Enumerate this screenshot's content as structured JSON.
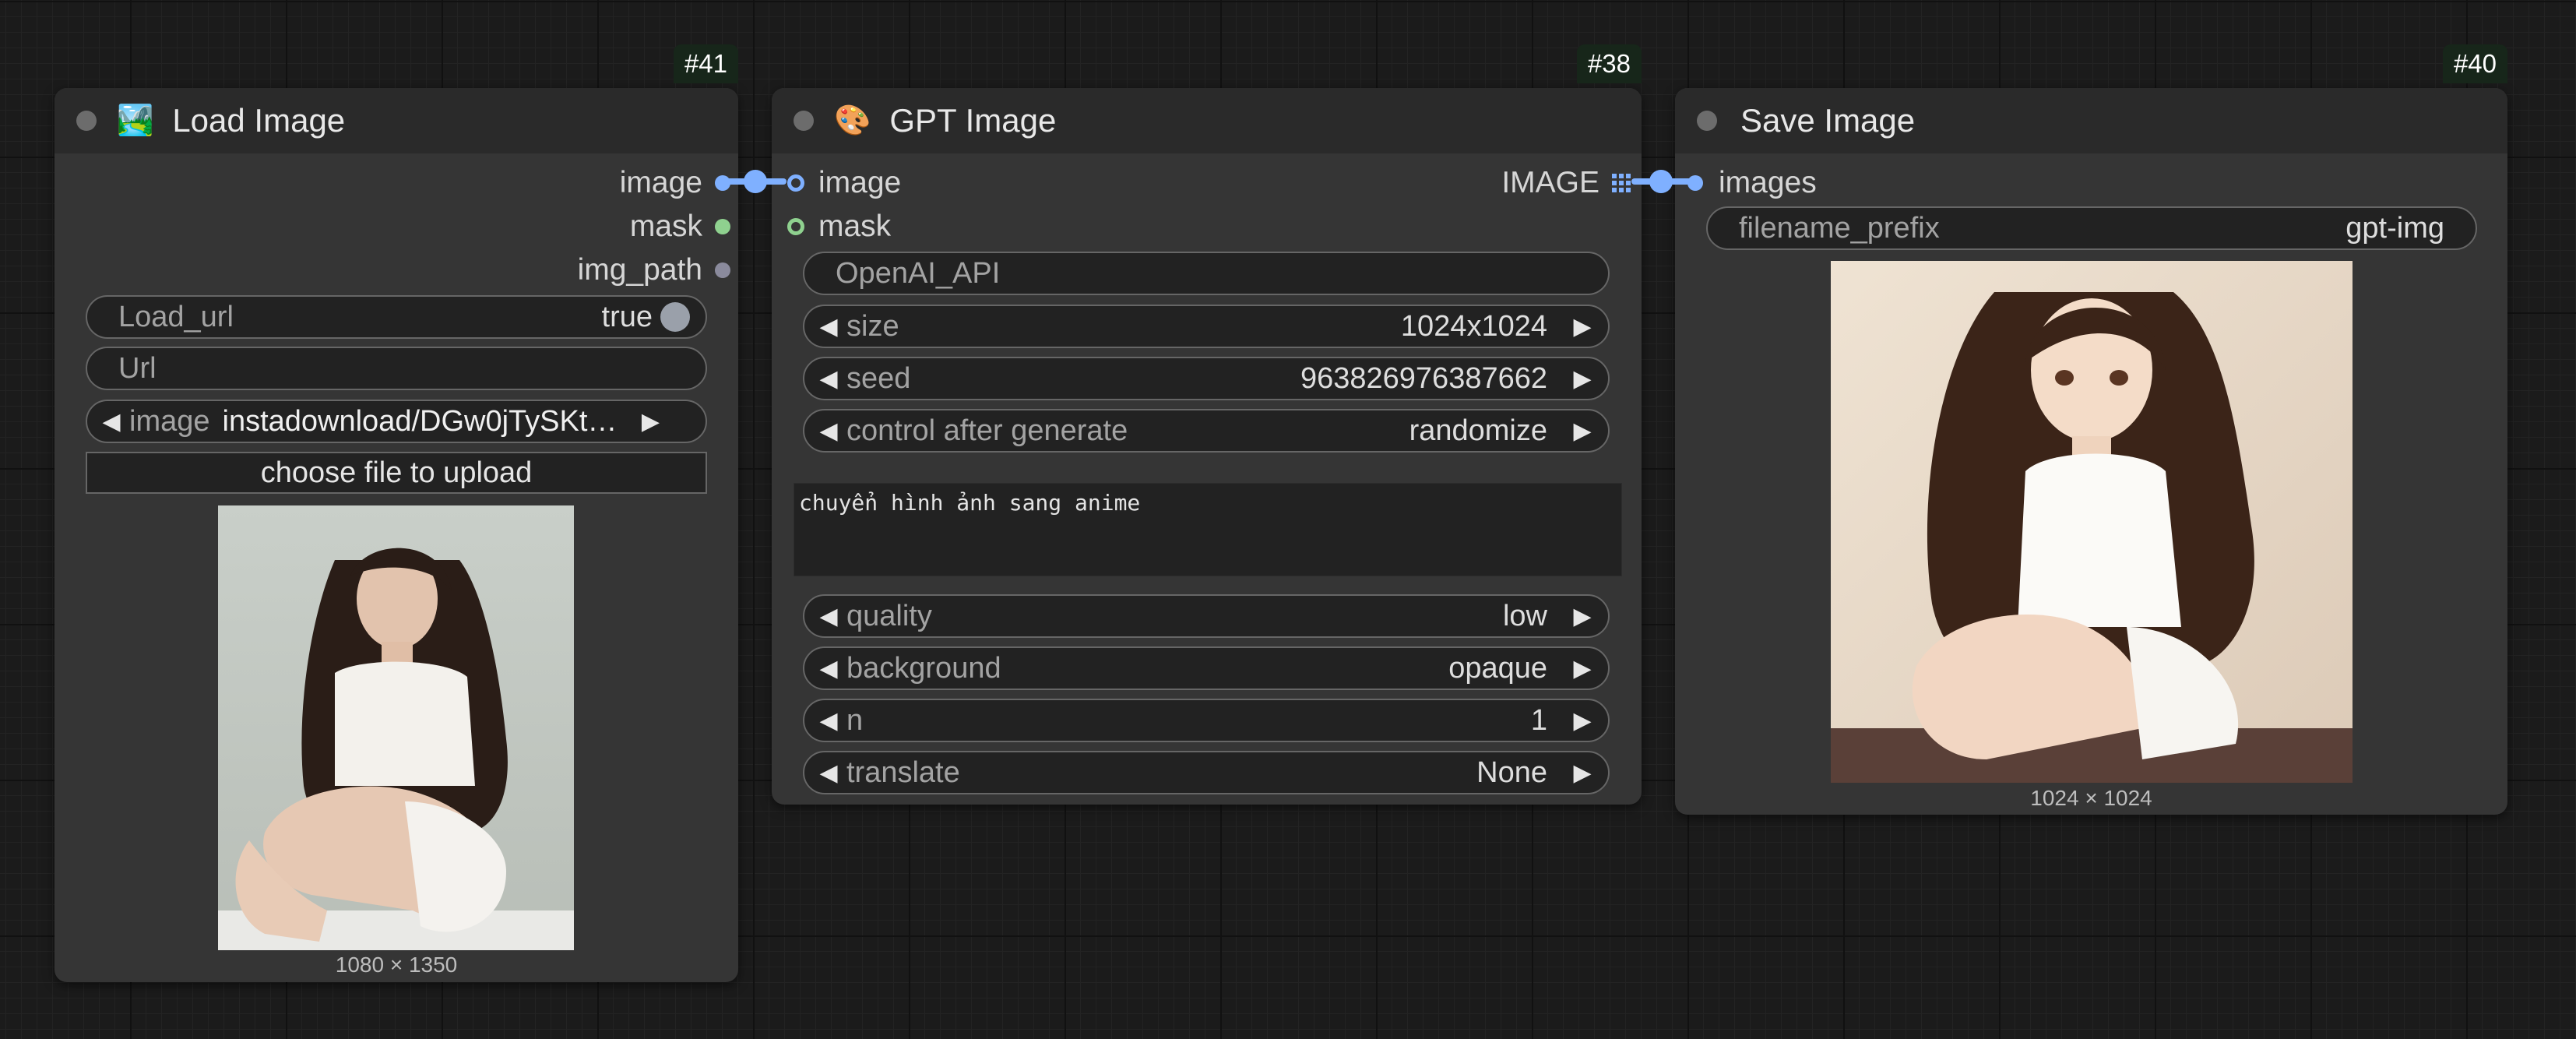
{
  "nodes": {
    "load_image": {
      "id": "#41",
      "title": "Load Image",
      "icon": "picture-icon",
      "outputs": [
        "image",
        "mask",
        "img_path"
      ],
      "load_url": {
        "label": "Load_url",
        "value": "true"
      },
      "url": {
        "placeholder": "Url"
      },
      "image_combo": {
        "label": "image",
        "value": "instadownload/DGw0jTySKt…"
      },
      "upload_button": "choose file to upload",
      "preview_dims": "1080 × 1350"
    },
    "gpt_image": {
      "id": "#38",
      "title": "GPT Image",
      "icon": "palette-icon",
      "inputs": [
        "image",
        "mask"
      ],
      "output": "IMAGE",
      "api_field": "OpenAI_API",
      "widgets": [
        {
          "label": "size",
          "value": "1024x1024"
        },
        {
          "label": "seed",
          "value": "963826976387662"
        },
        {
          "label": "control after generate",
          "value": "randomize"
        }
      ],
      "prompt": "chuyển hình ảnh sang anime",
      "widgets2": [
        {
          "label": "quality",
          "value": "low"
        },
        {
          "label": "background",
          "value": "opaque"
        },
        {
          "label": "n",
          "value": "1"
        },
        {
          "label": "translate",
          "value": "None"
        }
      ]
    },
    "save_image": {
      "id": "#40",
      "title": "Save Image",
      "input": "images",
      "filename_prefix": {
        "label": "filename_prefix",
        "value": "gpt-img"
      },
      "preview_dims": "1024 × 1024"
    }
  },
  "colors": {
    "canvas": "#1b1b1b",
    "node_body": "#353535",
    "node_header": "#2a2a2a",
    "image_link": "#7fb0ff",
    "mask_slot": "#8fd18f",
    "id_badge": "#17261a"
  }
}
